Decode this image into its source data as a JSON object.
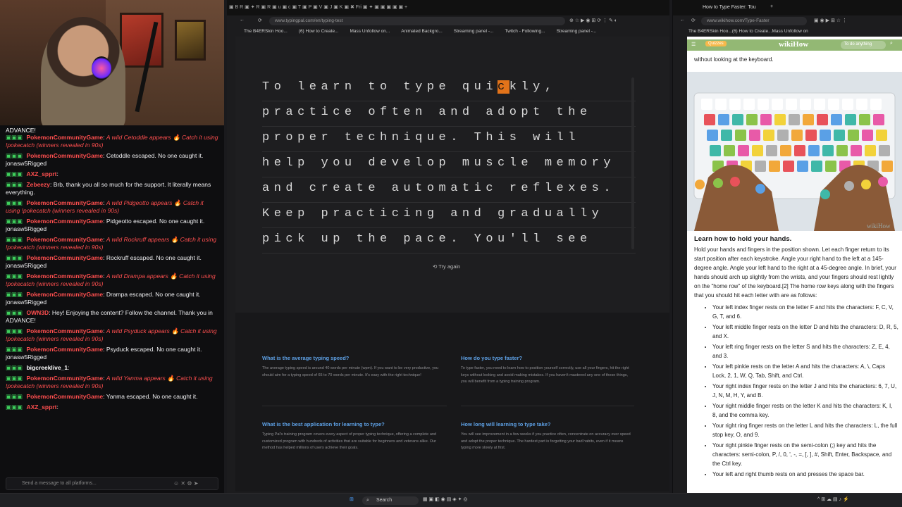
{
  "chat": {
    "top_text": "ADVANCE!",
    "messages": [
      {
        "user": "PokemonCommunityGame",
        "italic": true,
        "text": "A wild Cetoddle appears 🔥 Catch it using !pokecatch (winners revealed in 90s)"
      },
      {
        "user": "PokemonCommunityGame",
        "italic": false,
        "text": "Cetoddle escaped. No one caught it. jonasw5Rigged"
      },
      {
        "user": "AXZ_spprt",
        "italic": false,
        "text": ""
      },
      {
        "user": "Zebeezy",
        "italic": false,
        "text": "Brb, thank you all so much for the support. It literally means everything."
      },
      {
        "user": "PokemonCommunityGame",
        "italic": true,
        "text": "A wild Pidgeotto appears 🔥 Catch it using !pokecatch (winners revealed in 90s)"
      },
      {
        "user": "PokemonCommunityGame",
        "italic": false,
        "text": "Pidgeotto escaped. No one caught it. jonasw5Rigged"
      },
      {
        "user": "PokemonCommunityGame",
        "italic": true,
        "text": "A wild Rockruff appears 🔥 Catch it using !pokecatch (winners revealed in 90s)"
      },
      {
        "user": "PokemonCommunityGame",
        "italic": false,
        "text": "Rockruff escaped. No one caught it. jonasw5Rigged"
      },
      {
        "user": "PokemonCommunityGame",
        "italic": true,
        "text": "A wild Drampa appears 🔥 Catch it using !pokecatch (winners revealed in 90s)"
      },
      {
        "user": "PokemonCommunityGame",
        "italic": false,
        "text": "Drampa escaped. No one caught it. jonasw5Rigged"
      },
      {
        "user": "OWN3D",
        "italic": false,
        "text": "Hey! Enjoying the content? Follow the channel. Thank you in ADVANCE!"
      },
      {
        "user": "PokemonCommunityGame",
        "italic": true,
        "text": "A wild Psyduck appears 🔥 Catch it using !pokecatch (winners revealed in 90s)"
      },
      {
        "user": "PokemonCommunityGame",
        "italic": false,
        "text": "Psyduck escaped. No one caught it. jonasw5Rigged"
      },
      {
        "user": "bigcreeklive_1",
        "italic": false,
        "text": ""
      },
      {
        "user": "PokemonCommunityGame",
        "italic": true,
        "text": "A wild Yanma appears 🔥 Catch it using !pokecatch (winners revealed in 90s)"
      },
      {
        "user": "PokemonCommunityGame",
        "italic": false,
        "text": "Yanma escaped. No one caught it."
      },
      {
        "user": "AXZ_spprt",
        "italic": false,
        "text": ""
      }
    ],
    "input_placeholder": "Send a message to all platforms..."
  },
  "browser1": {
    "url": "www.typingpal.com/en/typing-test",
    "bookmarks": [
      "The B4ERSkin Hoo...",
      "(6) How to Create...",
      "Mass Unfollow on...",
      "Animated Backgro...",
      "Streaming panel -...",
      "Twitch - Following...",
      "Streaming panel -..."
    ],
    "typing_lines": [
      {
        "pre": "To learn to type qui",
        "cur": "c",
        "post": "kly,"
      },
      {
        "pre": "practice often and adopt the",
        "cur": "",
        "post": ""
      },
      {
        "pre": "proper technique. This will",
        "cur": "",
        "post": ""
      },
      {
        "pre": "help you develop muscle memory",
        "cur": "",
        "post": ""
      },
      {
        "pre": "and create automatic reflexes.",
        "cur": "",
        "post": ""
      },
      {
        "pre": "Keep practicing and gradually",
        "cur": "",
        "post": ""
      },
      {
        "pre": "pick up the pace. You'll see",
        "cur": "",
        "post": ""
      }
    ],
    "try_again": "Try again",
    "faq": [
      {
        "q": "What is the average typing speed?",
        "a": "The average typing speed is around 40 words per minute (wpm). If you want to be very productive, you should aim for a typing speed of 65 to 70 words per minute. It's easy with the right technique!"
      },
      {
        "q": "How do you type faster?",
        "a": "To type faster, you need to learn how to position yourself correctly, use all your fingers, hit the right keys without looking and avoid making mistakes. If you haven't mastered any one of these things, you will benefit from a typing training program."
      },
      {
        "q": "What is the best application for learning to type?",
        "a": "Typing Pal's training program covers every aspect of proper typing technique, offering a complete and customized program with hundreds of activities that are suitable for beginners and veterans alike. Our method has helped millions of users achieve their goals."
      },
      {
        "q": "How long will learning to type take?",
        "a": "You will see improvement in a few weeks if you practice often, concentrate on accuracy over speed and adopt the proper technique. The hardest part is forgetting your bad habits, even if it means typing more slowly at first."
      }
    ]
  },
  "browser2": {
    "tab_title": "How to Type Faster: Tou",
    "url": "www.wikihow.com/Type-Faster",
    "bookmarks": [
      "The B4ERSkin Hoo...",
      "(6) How to Create...",
      "Mass Unfollow on"
    ],
    "quizzes": "Quizzes",
    "logo": "wikiHow",
    "search_placeholder": "To do anything",
    "intro_line": "without looking at the keyboard.",
    "watermark": "wikiHow",
    "heading": "Learn how to hold your hands.",
    "paragraph": "Hold your hands and fingers in the position shown. Let each finger return to its start position after each keystroke. Angle your right hand to the left at a 145-degree angle. Angle your left hand to the right at a 45-degree angle. In brief, your hands should arch up slightly from the wrists, and your fingers should rest lightly on the \"home row\" of the keyboard.[2] The home row keys along with the fingers that you should hit each letter with are as follows:",
    "bullets": [
      "Your left index finger rests on the letter F and hits the characters: F, C, V, G, T, and 6.",
      "Your left middle finger rests on the letter D and hits the characters: D, R, 5, and X.",
      "Your left ring finger rests on the letter S and hits the characters: Z, E, 4, and 3.",
      "Your left pinkie rests on the letter A and hits the characters: A, \\, Caps Lock, 2, 1, W, Q, Tab, Shift, and Ctrl.",
      "Your right index finger rests on the letter J and hits the characters: 6, 7, U, J, N, M, H, Y, and B.",
      "Your right middle finger rests on the letter K and hits the characters: K, I, 8, and the comma key.",
      "Your right ring finger rests on the letter L and hits the characters: L, the full stop key, O, and 9.",
      "Your right pinkie finger rests on the semi-colon (;) key and hits the characters: semi-colon, P, /, 0, ', -, =, [, ], #, Shift, Enter, Backspace, and the Ctrl key.",
      "Your left and right thumb rests on and presses the space bar."
    ]
  },
  "taskbar": {
    "search": "Search"
  },
  "colors": {
    "accent": "#e2731a",
    "link": "#5ea1e6",
    "wikihow_green": "#93b874",
    "chat_user": "#ff4f4f"
  }
}
